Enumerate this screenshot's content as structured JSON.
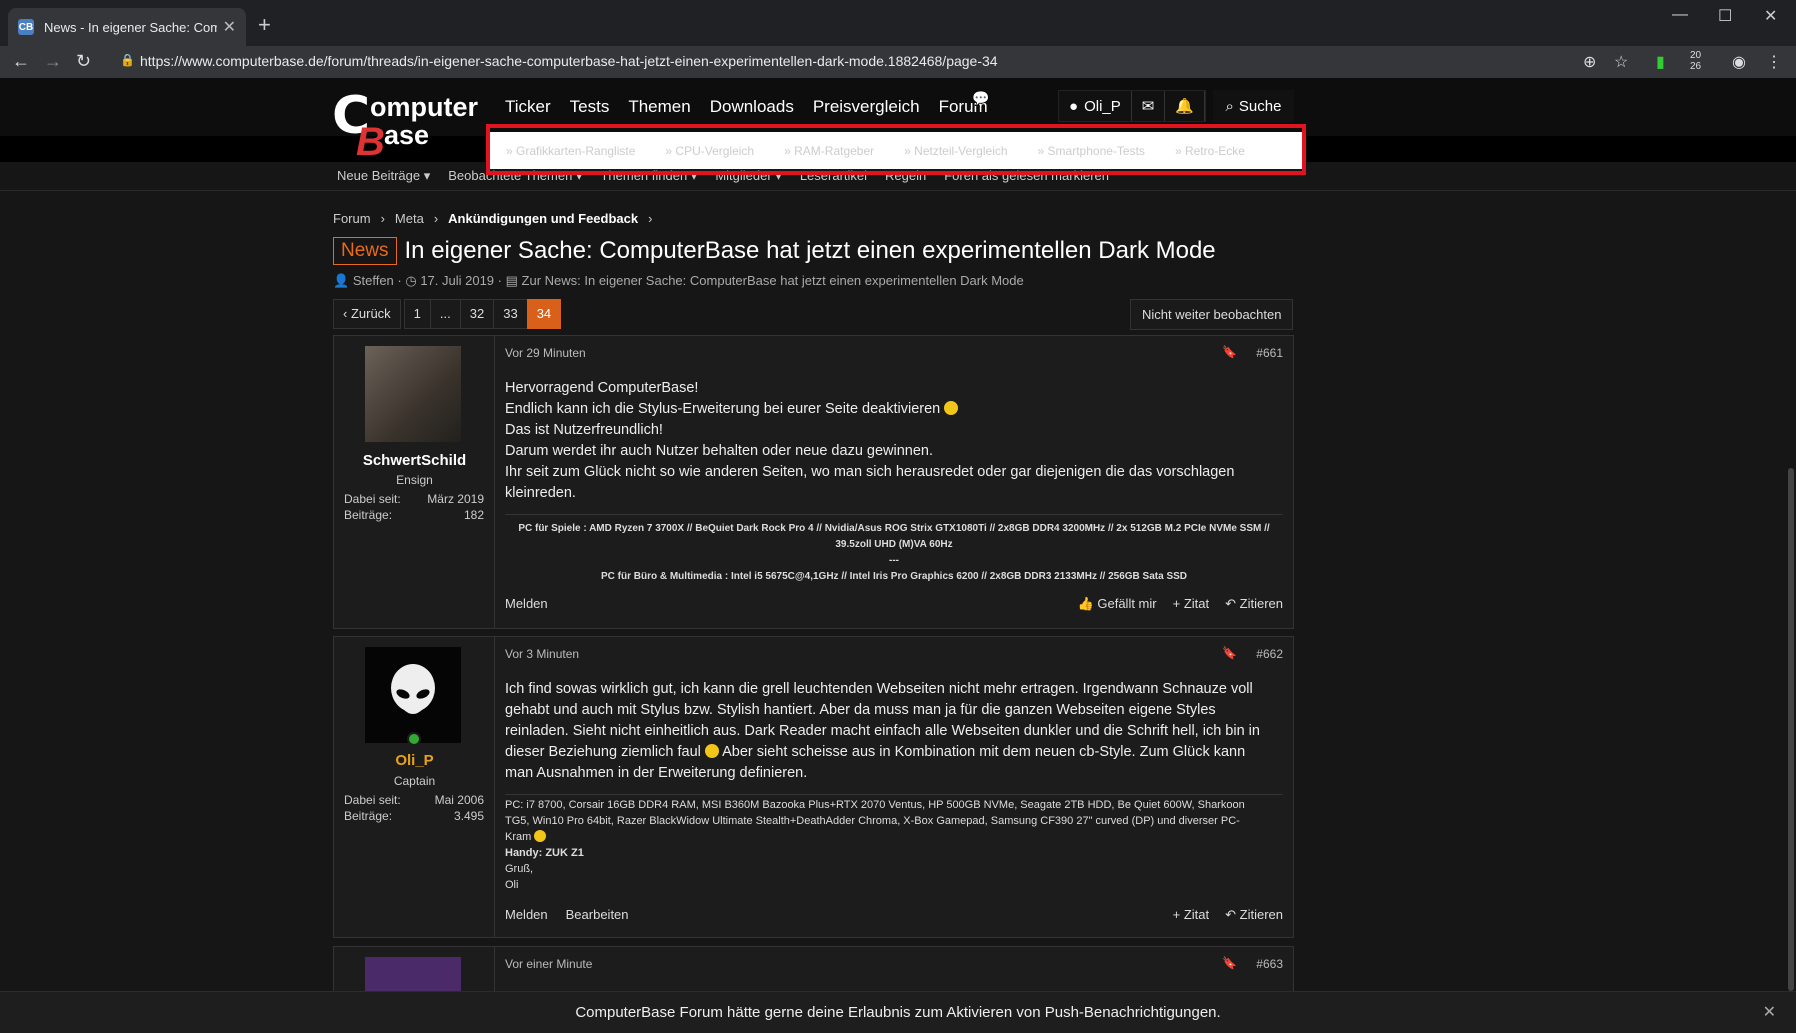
{
  "browser": {
    "tab_title": "News - In eigener Sache: Compu",
    "url": "https://www.computerbase.de/forum/threads/in-eigener-sache-computerbase-hat-jetzt-einen-experimentellen-dark-mode.1882468/page-34",
    "ext_badge": "20\n26"
  },
  "header": {
    "nav": [
      "Ticker",
      "Tests",
      "Themen",
      "Downloads",
      "Preisvergleich",
      "Forum"
    ],
    "username": "Oli_P",
    "search_label": "Suche"
  },
  "quicklinks": [
    "» Grafikkarten-Rangliste",
    "» CPU-Vergleich",
    "» RAM-Ratgeber",
    "» Netzteil-Vergleich",
    "» Smartphone-Tests",
    "» Retro-Ecke"
  ],
  "subnav": [
    "Neue Beiträge ▾",
    "Beobachtete Themen ▾",
    "Themen finden ▾",
    "Mitglieder ▾",
    "Leserartikel",
    "Regeln",
    "Foren als gelesen markieren"
  ],
  "breadcrumb": [
    "Forum",
    "Meta",
    "Ankündigungen und Feedback"
  ],
  "thread": {
    "badge": "News",
    "title": "In eigener Sache: ComputerBase hat jetzt einen experimentellen Dark Mode",
    "author": "Steffen",
    "date": "17. Juli 2019",
    "news_link": "Zur News: In eigener Sache: ComputerBase hat jetzt einen experimentellen Dark Mode"
  },
  "pager": {
    "prev": "‹ Zurück",
    "pages": [
      "1",
      "...",
      "32",
      "33",
      "34"
    ],
    "active": "34",
    "watch": "Nicht weiter beobachten"
  },
  "posts": [
    {
      "user": "SchwertSchild",
      "rank": "Ensign",
      "joined_label": "Dabei seit:",
      "joined": "März 2019",
      "posts_label": "Beiträge:",
      "posts": "182",
      "time": "Vor 29 Minuten",
      "number": "#661",
      "lines": [
        "Hervorragend ComputerBase!",
        "Endlich kann ich die Stylus-Erweiterung bei eurer Seite deaktivieren",
        "Das ist Nutzerfreundlich!",
        "Darum werdet ihr auch Nutzer behalten oder neue dazu gewinnen.",
        "Ihr seit zum Glück nicht so wie anderen Seiten, wo man sich herausredet oder gar diejenigen die das vorschlagen",
        "kleinreden."
      ],
      "sig": [
        "PC für Spiele : AMD Ryzen 7 3700X // BeQuiet Dark Rock Pro 4 // Nvidia/Asus ROG Strix GTX1080Ti // 2x8GB DDR4 3200MHz // 2x 512GB M.2 PCIe NVMe SSM //",
        "39.5zoll UHD (M)VA 60Hz",
        "---",
        "PC für Büro & Multimedia : Intel i5 5675C@4,1GHz // Intel Iris Pro Graphics 6200 // 2x8GB DDR3 2133MHz // 256GB Sata SSD"
      ],
      "actions_left": [
        "Melden"
      ],
      "actions_right": [
        "Gefällt mir",
        "+ Zitat",
        "Zitieren"
      ]
    },
    {
      "user": "Oli_P",
      "rank": "Captain",
      "joined_label": "Dabei seit:",
      "joined": "Mai 2006",
      "posts_label": "Beiträge:",
      "posts": "3.495",
      "time": "Vor 3 Minuten",
      "number": "#662",
      "lines": [
        "Ich find sowas wirklich gut, ich kann die grell leuchtenden Webseiten nicht mehr ertragen. Irgendwann Schnauze voll",
        "gehabt und auch mit Stylus bzw. Stylish hantiert. Aber da muss man ja für die ganzen Webseiten eigene Styles",
        "reinladen. Sieht nicht einheitlich aus. Dark Reader macht einfach alle Webseiten dunkler und die Schrift hell, ich bin in",
        "dieser Beziehung ziemlich faul",
        "Aber sieht scheisse aus in Kombination mit dem neuen cb-Style. Zum Glück kann",
        "man Ausnahmen in der Erweiterung definieren."
      ],
      "sig": [
        "PC: i7 8700, Corsair 16GB DDR4 RAM, MSI B360M Bazooka Plus+RTX 2070 Ventus, HP 500GB NVMe, Seagate 2TB HDD, Be Quiet 600W, Sharkoon",
        "TG5, Win10 Pro 64bit, Razer BlackWidow Ultimate Stealth+DeathAdder Chroma, X-Box Gamepad, Samsung CF390 27\" curved (DP) und diverser PC-",
        "Kram",
        "Handy: ZUK Z1",
        "Gruß,",
        "Oli"
      ],
      "actions_left": [
        "Melden",
        "Bearbeiten"
      ],
      "actions_right": [
        "+ Zitat",
        "Zitieren"
      ]
    },
    {
      "time": "Vor einer Minute",
      "number": "#663"
    }
  ],
  "push": "ComputerBase Forum hätte gerne deine Erlaubnis zum Aktivieren von Push-Benachrichtigungen.",
  "colors": {
    "accent": "#d8601a",
    "highlight_frame": "#e0141e",
    "brand_red": "#d33"
  }
}
